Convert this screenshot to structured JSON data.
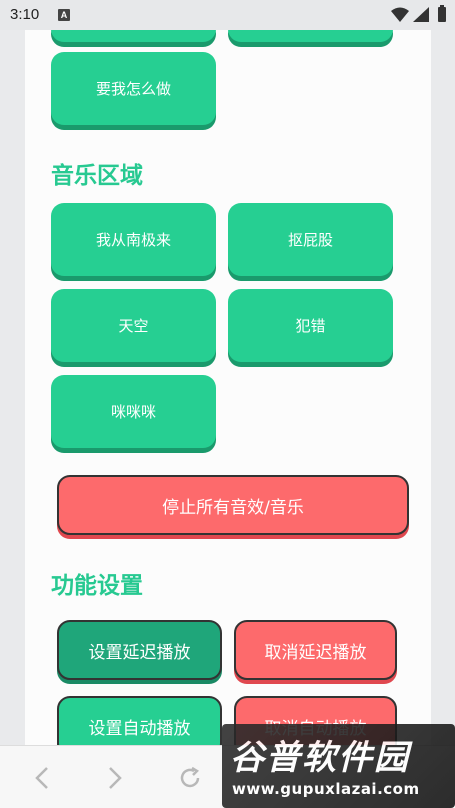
{
  "status_bar": {
    "time": "3:10",
    "notification_icon": "A"
  },
  "top_buttons": {
    "partial_left": "",
    "partial_right": "",
    "item": "要我怎么做"
  },
  "music_section": {
    "title": "音乐区域",
    "buttons": [
      "我从南极来",
      "抠屁股",
      "天空",
      "犯错",
      "咪咪咪"
    ]
  },
  "stop_all_button": "停止所有音效/音乐",
  "settings_section": {
    "title": "功能设置",
    "set_delay": "设置延迟播放",
    "cancel_delay": "取消延迟播放",
    "set_auto": "设置自动播放",
    "cancel_auto": "取消自动播放"
  },
  "nav": {
    "back_icon": "chevron-left",
    "forward_icon": "chevron-right",
    "refresh_icon": "refresh"
  },
  "watermark": {
    "title": "谷普软件园",
    "url": "www.gupuxlazai.com"
  },
  "colors": {
    "green": "#26cf92",
    "green_dark": "#1fa67a",
    "red": "#fd6a6c",
    "title_green": "#27c991"
  }
}
